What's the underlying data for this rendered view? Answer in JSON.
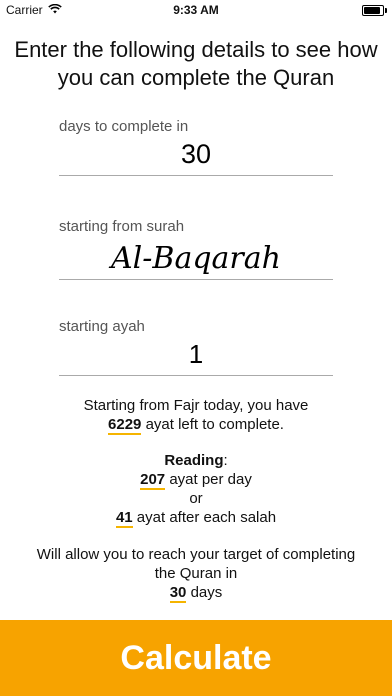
{
  "status_bar": {
    "carrier": "Carrier",
    "time": "9:33 AM"
  },
  "heading": "Enter the following details to see how you can complete the Quran",
  "fields": [
    {
      "label": "days to complete in",
      "value": "30"
    },
    {
      "label": "starting from surah",
      "value": "Al-Baqarah"
    },
    {
      "label": "starting ayah",
      "value": "1"
    }
  ],
  "summary": {
    "line1": "Starting from Fajr today, you have",
    "ayat_left": "6229",
    "ayat_left_suffix": "ayat left to complete.",
    "reading_label": "Reading",
    "per_day": "207",
    "per_day_suffix": "ayat per day",
    "or": "or",
    "per_salah": "41",
    "per_salah_suffix": "ayat after each salah",
    "target_line1": "Will allow you to reach your target of completing",
    "target_line2": "the Quran in",
    "days": "30",
    "days_suffix": "days"
  },
  "calculate_label": "Calculate",
  "colors": {
    "accent": "#f7a300",
    "underline": "#f5b400"
  }
}
